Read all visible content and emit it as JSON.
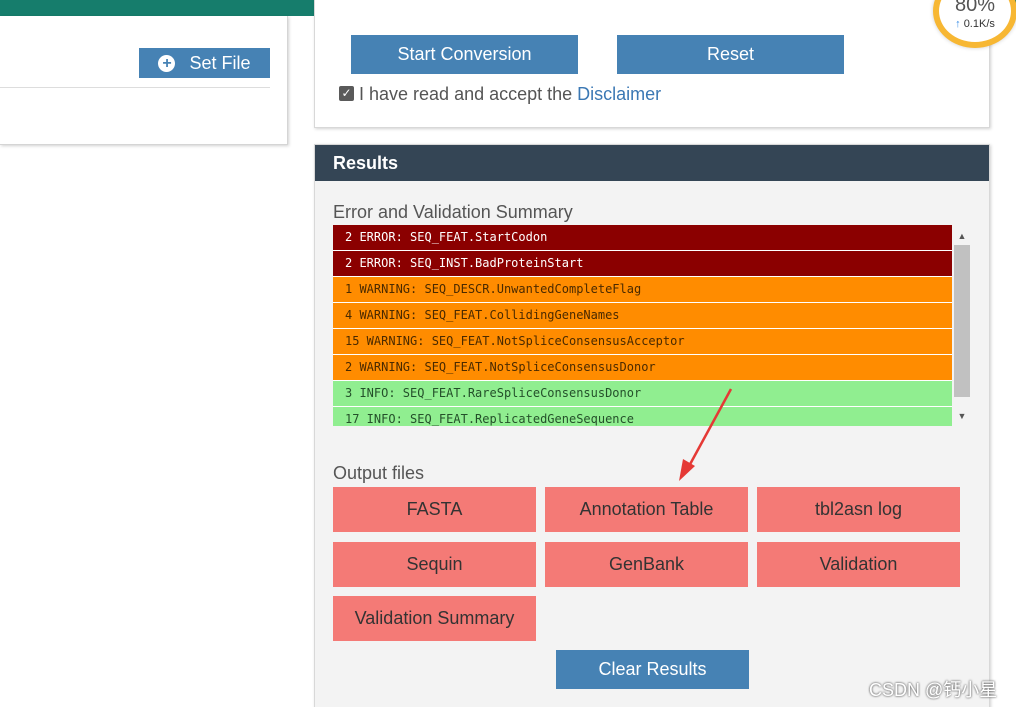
{
  "network_widget": {
    "percent": "80%",
    "rate": "0.1K/s",
    "up_arrow": "↑"
  },
  "left_panel": {
    "set_file_label": "Set File",
    "icon": "plus-circle-icon"
  },
  "actions": {
    "start_label": "Start Conversion",
    "reset_label": "Reset",
    "accept_text": "I have read and accept the",
    "disclaimer_link": "Disclaimer",
    "accept_checked": true
  },
  "results": {
    "title": "Results",
    "summary_label": "Error and Validation Summary",
    "summary_rows": [
      {
        "text": "2 ERROR: SEQ_FEAT.StartCodon",
        "level": "error"
      },
      {
        "text": "2 ERROR: SEQ_INST.BadProteinStart",
        "level": "error"
      },
      {
        "text": "1 WARNING: SEQ_DESCR.UnwantedCompleteFlag",
        "level": "warning"
      },
      {
        "text": "4 WARNING: SEQ_FEAT.CollidingGeneNames",
        "level": "warning"
      },
      {
        "text": "15 WARNING: SEQ_FEAT.NotSpliceConsensusAcceptor",
        "level": "warning"
      },
      {
        "text": "2 WARNING: SEQ_FEAT.NotSpliceConsensusDonor",
        "level": "warning"
      },
      {
        "text": "3 INFO: SEQ_FEAT.RareSpliceConsensusDonor",
        "level": "info"
      },
      {
        "text": "17 INFO: SEQ_FEAT.ReplicatedGeneSequence",
        "level": "info"
      }
    ],
    "output_label": "Output files",
    "output_buttons": [
      "FASTA",
      "Annotation Table",
      "tbl2asn log",
      "Sequin",
      "GenBank",
      "Validation",
      "Validation Summary"
    ],
    "clear_label": "Clear Results"
  },
  "colors": {
    "error": "#8b0000",
    "warning": "#ff8c00",
    "info": "#90ee90",
    "output_button": "#f47a76",
    "primary_button": "#4682b4",
    "results_header": "#344555",
    "annotation_arrow": "#e53935"
  },
  "watermark": "CSDN @钙小星"
}
